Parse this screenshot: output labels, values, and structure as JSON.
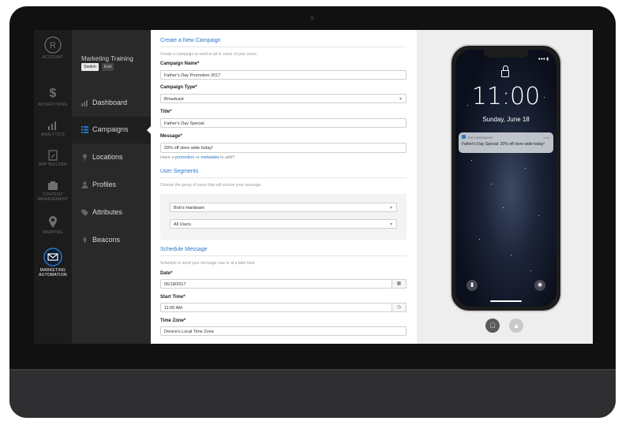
{
  "rail": {
    "account": "ACCOUNT",
    "advertising": "ADVERTISING",
    "analytics": "ANALYTICS",
    "app_builder": "APP BUILDER",
    "content_mgmt_1": "CONTENT",
    "content_mgmt_2": "MANAGEMENT",
    "mapping": "MAPPING",
    "marketing_1": "MARKETING",
    "marketing_2": "AUTOMATION"
  },
  "nav": {
    "account_name": "Marketing Training",
    "switch_label": "Switch",
    "exit_label": "Exit",
    "items": [
      {
        "label": "Dashboard",
        "icon": "bar-chart-icon"
      },
      {
        "label": "Campaigns",
        "icon": "list-icon"
      },
      {
        "label": "Locations",
        "icon": "pin-icon"
      },
      {
        "label": "Profiles",
        "icon": "user-icon"
      },
      {
        "label": "Attributes",
        "icon": "tag-icon"
      },
      {
        "label": "Beacons",
        "icon": "beacon-icon"
      }
    ]
  },
  "form": {
    "title": "Create a New Campaign",
    "subtitle": "Create a campaign to send to all or some of your users.",
    "campaign_name_label": "Campaign Name*",
    "campaign_name_value": "Father's Day Promotion 2017",
    "campaign_type_label": "Campaign Type*",
    "campaign_type_value": "Broadcast",
    "title_label": "Title*",
    "title_value": "Father's Day Special",
    "message_label": "Message*",
    "message_value": "20% off store wide today!",
    "hint_prefix": "Have a",
    "hint_link1": "promotion",
    "hint_or": "or",
    "hint_link2": "metadata",
    "hint_suffix": "to add?",
    "segments_title": "User Segments",
    "segments_help": "Choose the group of users that will receive your message.",
    "segment_1": "Bob's Hardware",
    "segment_2": "All Users",
    "schedule_title": "Schedule Message",
    "schedule_help": "Schedule to send your message now or at a later time.",
    "date_label": "Date*",
    "date_value": "06/18/2017",
    "start_time_label": "Start Time*",
    "start_time_value": "11:00 AM",
    "time_zone_label": "Time Zone*",
    "time_zone_value": "Device's Local Time Zone"
  },
  "preview": {
    "time": "11:00",
    "date": "Sunday, June 18",
    "app_name": "THE HARDWARE",
    "now": "now",
    "notification": "Father's Day Special: 20% off store wide today!"
  },
  "colors": {
    "accent": "#2a77c9",
    "rail_bg": "#1c1c1c",
    "nav_bg": "#292929"
  }
}
